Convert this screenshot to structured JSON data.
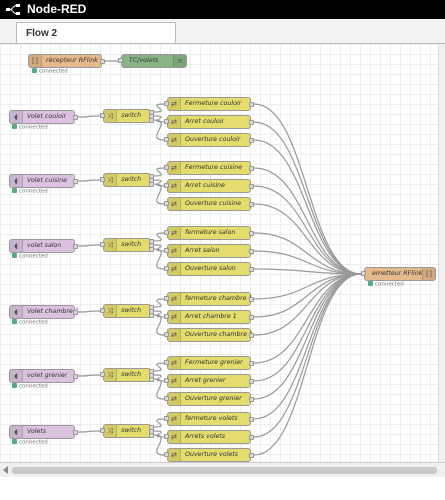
{
  "app": {
    "title": "Node-RED",
    "logo_icon": "node-red-logo-icon"
  },
  "tabs": [
    {
      "label": "Flow 2",
      "active": true
    }
  ],
  "status_text": "connected",
  "colors": {
    "header": "#000000",
    "rfx_node": "#e5b98a",
    "inject_node": "#dbc3e0",
    "switch_node": "#e4dc6c",
    "change_node": "#e4dc6c",
    "debug_node": "#88b485",
    "status_connected": "#55aa88",
    "wire": "#999999"
  },
  "top_nodes": {
    "receiver": {
      "label": "récepteur RFlink",
      "icon": "rflink-icon",
      "status": "connected"
    },
    "debug": {
      "label": "TC/volets",
      "icon": "debug-list-icon"
    }
  },
  "output_node": {
    "label": "emetteur RFlink",
    "icon": "rflink-icon",
    "status": "connected"
  },
  "groups": [
    {
      "inject": "Volet couloir",
      "switch": "switch",
      "status": "connected",
      "changes": [
        "Fermeture couloir",
        "Arret couloir",
        "Ouverture couloir"
      ]
    },
    {
      "inject": "Volet cuisine",
      "switch": "switch",
      "status": "connected",
      "changes": [
        "Fermeture cuisine",
        "Arret cuisine",
        "Ouverture cuisine"
      ]
    },
    {
      "inject": "volet salon",
      "switch": "switch",
      "status": "connected",
      "changes": [
        "fermeture salon",
        "Arret salon",
        "Ouverture salon"
      ]
    },
    {
      "inject": "Volet chambre 1",
      "switch": "switch",
      "status": "connected",
      "changes": [
        "fermeture chambre 1",
        "Arret chambre 1",
        "Ouverture chambre 1"
      ]
    },
    {
      "inject": "volet grenier",
      "switch": "switch",
      "status": "connected",
      "changes": [
        "Fermeture grenier",
        "Arret grenier",
        "Ouverture grenier"
      ]
    },
    {
      "inject": "Volets",
      "switch": "switch",
      "status": "connected",
      "changes": [
        "fermeture volets",
        "Arrets volets",
        "Ouverture volets"
      ]
    }
  ]
}
